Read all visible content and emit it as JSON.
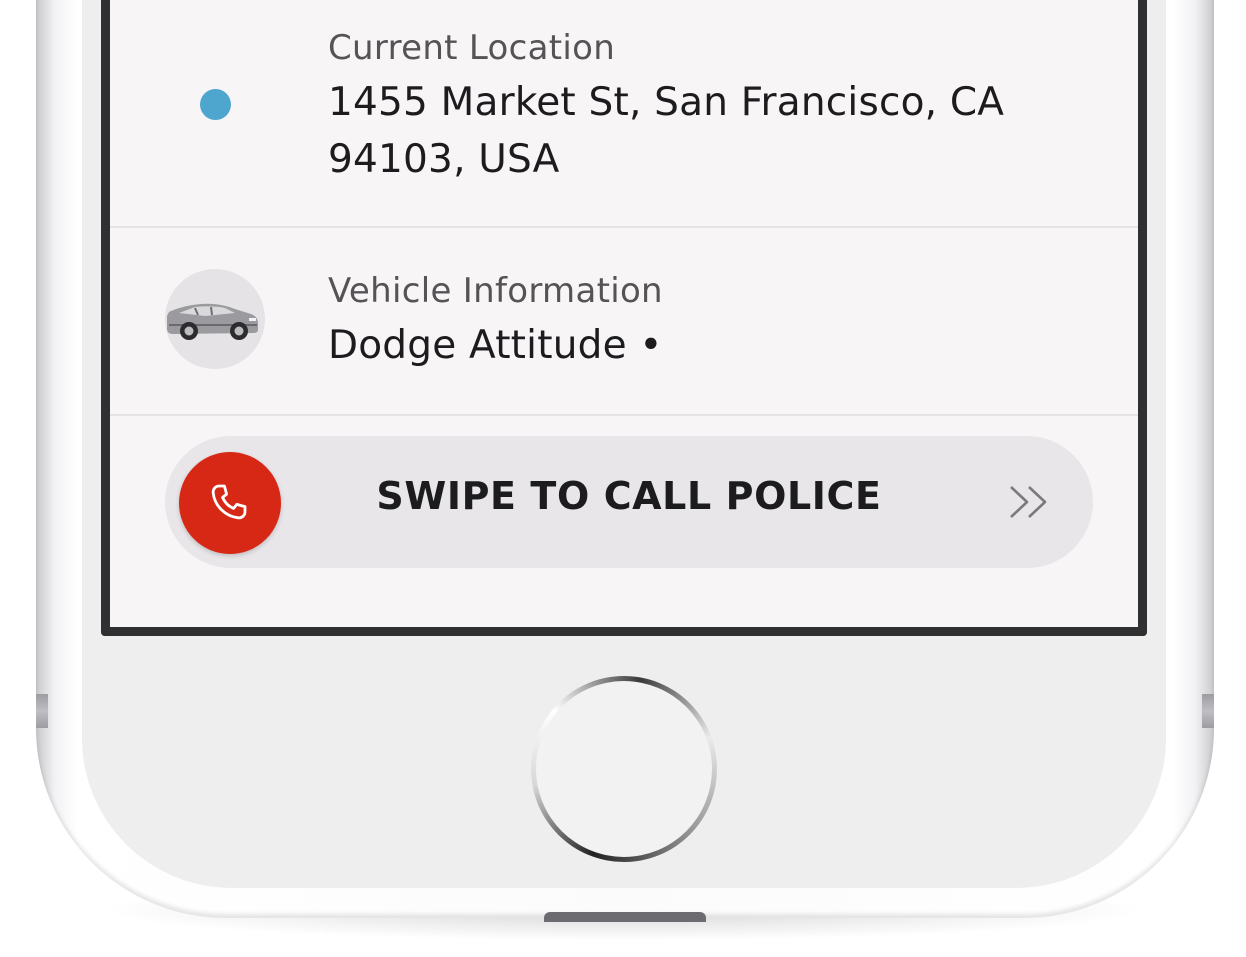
{
  "safety_panel": {
    "location": {
      "label": "Current Location",
      "address": "1455 Market St, San Francisco, CA 94103, USA",
      "icon": "location-dot-icon",
      "dot_color": "#4ea6cf"
    },
    "vehicle": {
      "label": "Vehicle Information",
      "value": "Dodge Attitude •",
      "icon": "car-icon"
    },
    "swipe_action": {
      "label": "SWIPE TO CALL POLICE",
      "knob_icon": "phone-icon",
      "hint_icon": "double-chevron-right-icon",
      "accent_color": "#d72715"
    }
  },
  "device": {
    "home_button_icon": "home-button"
  }
}
